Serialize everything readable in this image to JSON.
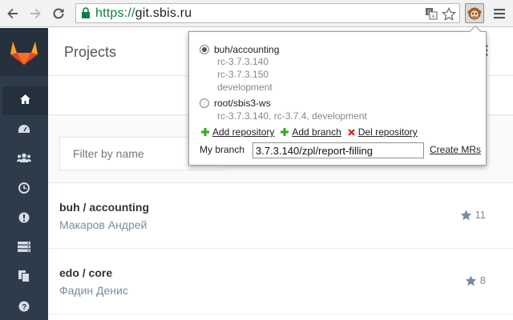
{
  "browser": {
    "url_scheme": "https://",
    "url_host": "git.sbis.ru",
    "icons": [
      "back-arrow-icon",
      "forward-arrow-icon",
      "reload-icon",
      "lock-icon",
      "translate-icon",
      "star-icon",
      "extension-icon",
      "menu-icon"
    ]
  },
  "sidebar": {
    "items": [
      {
        "icon": "home-icon"
      },
      {
        "icon": "dashboard-icon"
      },
      {
        "icon": "groups-icon"
      },
      {
        "icon": "clock-icon"
      },
      {
        "icon": "issues-icon"
      },
      {
        "icon": "server-icon"
      },
      {
        "icon": "copy-icon"
      },
      {
        "icon": "help-icon"
      }
    ]
  },
  "header": {
    "title": "Projects"
  },
  "filter": {
    "placeholder": "Filter by name"
  },
  "projects": [
    {
      "name": "buh / accounting",
      "owner": "Макаров Андрей",
      "stars": "11"
    },
    {
      "name": "edo / core",
      "owner": "Фадин Денис",
      "stars": "8"
    }
  ],
  "popup": {
    "repos": [
      {
        "name": "buh/accounting",
        "selected": true,
        "branches": [
          "rc-3.7.3.140",
          "rc-3.7.3.150",
          "development"
        ]
      },
      {
        "name": "root/sbis3-ws",
        "selected": false,
        "branches": [
          "rc-3.7.3.140, rc-3.7.4, development"
        ]
      }
    ],
    "add_repository": "Add repository",
    "add_branch": "Add branch",
    "del_repository": "Del repository",
    "my_branch_label": "My branch",
    "my_branch_value": "3.7.3.140/zpl/report-filling",
    "create_mrs": "Create MRs"
  },
  "colors": {
    "sidebar_bg": "#2e3b4a",
    "secure_green": "#0b8043",
    "muted_blue": "#7a8ca0",
    "add_green": "#33aa22",
    "delete_red": "#cc2222"
  }
}
